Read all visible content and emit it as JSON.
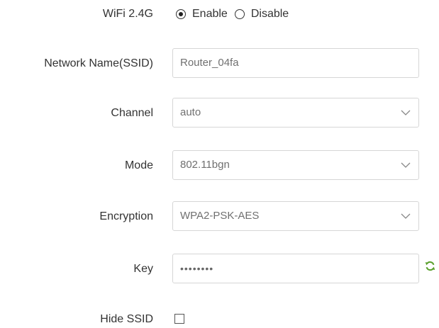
{
  "wifi": {
    "label": "WiFi 2.4G",
    "options": [
      {
        "label": "Enable",
        "selected": true
      },
      {
        "label": "Disable",
        "selected": false
      }
    ]
  },
  "ssid": {
    "label": "Network Name(SSID)",
    "value": "Router_04fa"
  },
  "channel": {
    "label": "Channel",
    "value": "auto"
  },
  "mode": {
    "label": "Mode",
    "value": "802.11bgn"
  },
  "encryption": {
    "label": "Encryption",
    "value": "WPA2-PSK-AES"
  },
  "key": {
    "label": "Key",
    "masked_value": "••••••••"
  },
  "hide_ssid": {
    "label": "Hide SSID",
    "checked": false
  },
  "icons": {
    "dropdown": "chevron-down-icon",
    "refresh": "refresh-icon"
  },
  "colors": {
    "refresh_icon": "#5aa02c",
    "field_border": "#d6d6d6",
    "field_text": "#707070"
  }
}
